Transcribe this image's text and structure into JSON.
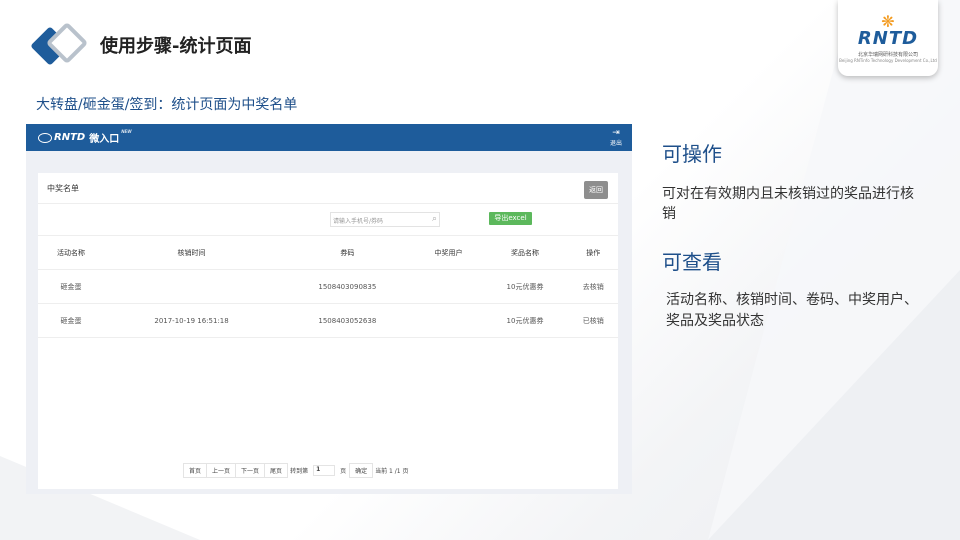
{
  "slide": {
    "title": "使用步骤-统计页面",
    "subtitle": "大转盘/砸金蛋/签到：统计页面为中奖名单",
    "brand": {
      "name": "RNTD",
      "sub": "北京华瑞网研科技有限公司",
      "sub_en": "Beijing RNTinfo Technology Development Co.,Ltd"
    }
  },
  "app": {
    "logo": "RNTD",
    "logo_cn": "微入口",
    "logo_badge": "NEW",
    "logout_label": "退出",
    "panel_title": "中奖名单",
    "back_label": "返回",
    "search_placeholder": "请输入手机号/券码",
    "export_label": "导出excel",
    "columns": [
      "活动名称",
      "核销时间",
      "券码",
      "中奖用户",
      "奖品名称",
      "操作"
    ],
    "rows": [
      [
        "砸金蛋",
        "",
        "1508403090835",
        "",
        "10元优惠券",
        "去核销"
      ],
      [
        "砸金蛋",
        "2017-10-19 16:51:18",
        "1508403052638",
        "",
        "10元优惠券",
        "已核销"
      ]
    ],
    "pager": {
      "first": "首页",
      "prev": "上一页",
      "next": "下一页",
      "last": "尾页",
      "jump_label": "转到第",
      "jump_value": "1",
      "page_unit": "页",
      "confirm": "确定",
      "current": "当前 1 /1 页"
    }
  },
  "notes": {
    "operate_heading": "可操作",
    "operate_text": "可对在有效期内且未核销过的奖品进行核销",
    "view_heading": "可查看",
    "view_text": "活动名称、核销时间、卷码、中奖用户、奖品及奖品状态"
  },
  "colors": {
    "primary": "#1e5c9b",
    "export": "#5cb85c",
    "accent_orange": "#f39a1e"
  }
}
